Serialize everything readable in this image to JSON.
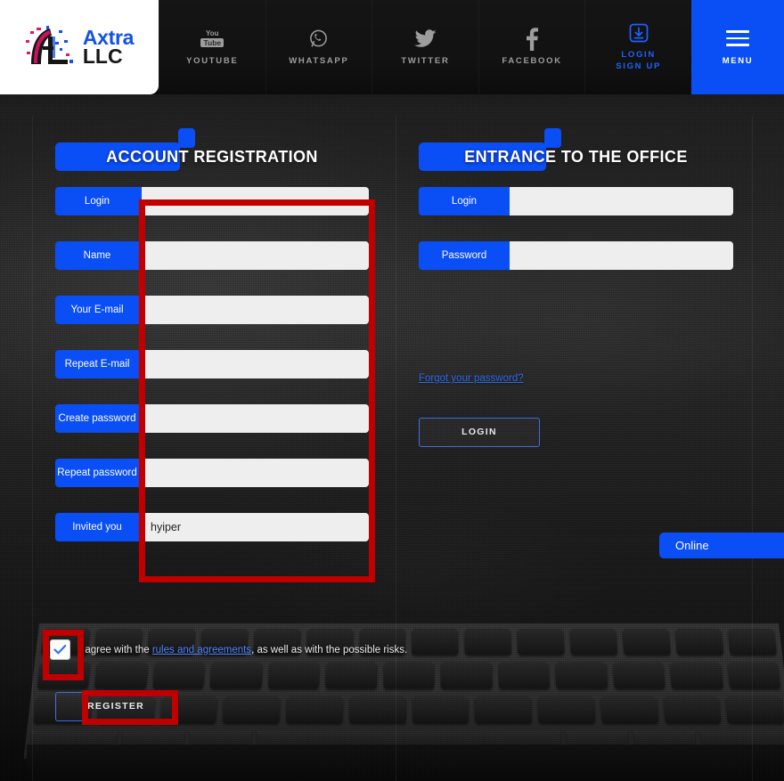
{
  "brand": {
    "name_line1": "Axtra",
    "name_line2": "LLC",
    "logo_icon": "axtra-glitch-a-logo",
    "blue": "#0a4ef5",
    "pink": "#e8136b"
  },
  "topnav": {
    "items": [
      {
        "id": "youtube",
        "label": "YOUTUBE",
        "icon": "youtube-icon"
      },
      {
        "id": "whatsapp",
        "label": "WHATSAPP",
        "icon": "whatsapp-icon"
      },
      {
        "id": "twitter",
        "label": "TWITTER",
        "icon": "twitter-bird-icon"
      },
      {
        "id": "facebook",
        "label": "FACEBOOK",
        "icon": "facebook-f-icon"
      }
    ],
    "login": {
      "label_line1": "LOGIN",
      "label_line2": "SIGN UP",
      "icon": "download-box-icon"
    },
    "menu": {
      "label": "MENU",
      "icon": "hamburger-icon"
    }
  },
  "registration": {
    "heading_highlight": "ACCOUNT",
    "heading_rest": "REGISTRATION",
    "heading_full": "ACCOUNT REGISTRATION",
    "fields": [
      {
        "label": "Login",
        "value": "",
        "placeholder": ""
      },
      {
        "label": "Name",
        "value": "",
        "placeholder": ""
      },
      {
        "label": "Your E-mail",
        "value": "",
        "placeholder": ""
      },
      {
        "label": "Repeat E-mail",
        "value": "",
        "placeholder": ""
      },
      {
        "label": "Create password",
        "value": "",
        "placeholder": ""
      },
      {
        "label": "Repeat password",
        "value": "",
        "placeholder": ""
      },
      {
        "label": "Invited you",
        "value": "hyiper",
        "placeholder": ""
      }
    ],
    "agreement": {
      "checked": true,
      "text_before": "I agree with the ",
      "link_text": "rules and agreements",
      "text_after": ", as well as with the possible risks."
    },
    "register_label": "REGISTER"
  },
  "entrance": {
    "heading_highlight": "ENTRANCE",
    "heading_rest": "TO THE OFFICE",
    "heading_full": "ENTRANCE TO THE OFFICE",
    "fields": [
      {
        "label": "Login",
        "value": "",
        "placeholder": ""
      },
      {
        "label": "Password",
        "value": "",
        "placeholder": ""
      }
    ],
    "forgot_label": "Forgot your password?",
    "login_label": "LOGIN"
  },
  "chat": {
    "label": "Online"
  },
  "annotations": {
    "color": "#c00000",
    "boxes": [
      "registration-input-column",
      "agreement-checkbox",
      "register-button"
    ]
  }
}
